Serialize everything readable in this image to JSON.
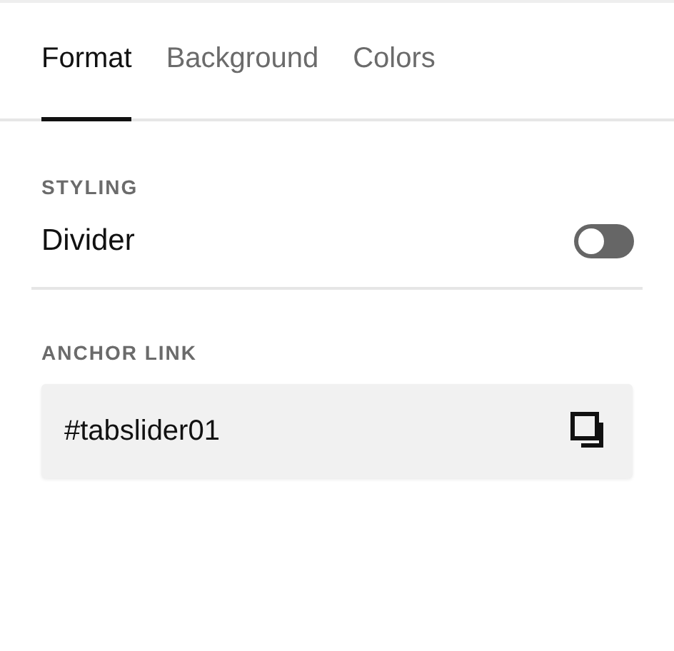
{
  "tabs": [
    {
      "label": "Format",
      "selected": true
    },
    {
      "label": "Background",
      "selected": false
    },
    {
      "label": "Colors",
      "selected": false
    }
  ],
  "styling": {
    "heading": "STYLING",
    "toggle": {
      "label": "Divider",
      "on": false
    }
  },
  "anchor_link": {
    "heading": "ANCHOR LINK",
    "value": "#tabslider01"
  }
}
